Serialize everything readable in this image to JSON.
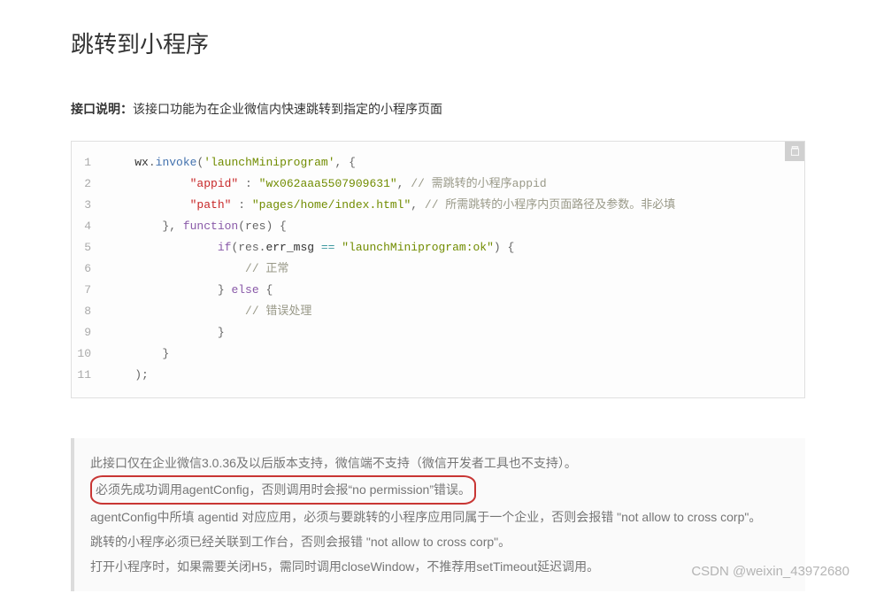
{
  "title": "跳转到小程序",
  "intro": {
    "label": "接口说明：",
    "text": "该接口功能为在企业微信内快速跳转到指定的小程序页面"
  },
  "code": {
    "line1": {
      "obj": "wx",
      "dot": ".",
      "fn": "invoke",
      "lp": "(",
      "arg1": "'launchMiniprogram'",
      "cm": ", {"
    },
    "line2": {
      "key": "\"appid\"",
      "colon": " : ",
      "val": "\"wx062aaa5507909631\"",
      "cm": ", ",
      "comment": "// 需跳转的小程序appid"
    },
    "line3": {
      "key": "\"path\"",
      "colon": " : ",
      "val": "\"pages/home/index.html\"",
      "cm": ", ",
      "comment": "// 所需跳转的小程序内页面路径及参数。非必填"
    },
    "line4": {
      "rb": "}, ",
      "fn": "function",
      "lp": "(res) {"
    },
    "line5": {
      "if": "if",
      "lp": "(res.",
      "err": "err_msg",
      "eq": " == ",
      "str": "\"launchMiniprogram:ok\"",
      "rp": ") {"
    },
    "line6": {
      "comment": "// 正常"
    },
    "line7": {
      "rb": "} ",
      "else": "else",
      "lb": " {"
    },
    "line8": {
      "comment": "// 错误处理"
    },
    "line9": {
      "rb": "}"
    },
    "line10": {
      "rb": "}"
    },
    "line11": {
      "end": ");"
    }
  },
  "notes": {
    "n1": "此接口仅在企业微信3.0.36及以后版本支持，微信端不支持（微信开发者工具也不支持）。",
    "n2": "必须先成功调用agentConfig，否则调用时会报“no permission”错误。",
    "n3": "agentConfig中所填 agentid 对应应用，必须与要跳转的小程序应用同属于一个企业，否则会报错 \"not allow to cross corp\"。",
    "n4": "跳转的小程序必须已经关联到工作台，否则会报错 \"not allow to cross corp\"。",
    "n5": "打开小程序时，如果需要关闭H5，需同时调用closeWindow，不推荐用setTimeout延迟调用。"
  },
  "watermark": "CSDN @weixin_43972680"
}
